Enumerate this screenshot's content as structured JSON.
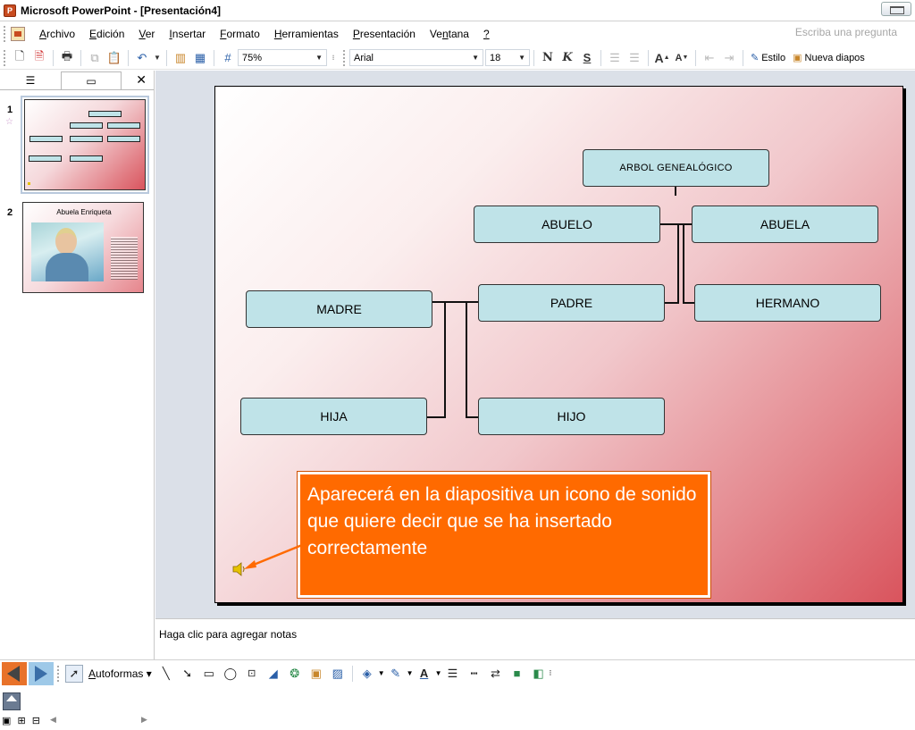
{
  "window": {
    "title": "Microsoft PowerPoint - [Presentación4]"
  },
  "menubar": {
    "items": [
      {
        "label": "Archivo",
        "key": "A",
        "rest": "rchivo"
      },
      {
        "label": "Edición",
        "key": "E",
        "rest": "dición"
      },
      {
        "label": "Ver",
        "key": "V",
        "rest": "er"
      },
      {
        "label": "Insertar",
        "key": "I",
        "rest": "nsertar"
      },
      {
        "label": "Formato",
        "key": "F",
        "rest": "ormato"
      },
      {
        "label": "Herramientas",
        "key": "H",
        "rest": "erramientas"
      },
      {
        "label": "Presentación",
        "key": "P",
        "rest": "resentación"
      },
      {
        "label": "Ventana",
        "pre": "Ve",
        "key": "n",
        "rest": "tana"
      },
      {
        "label": "?",
        "key": "?",
        "rest": ""
      }
    ],
    "ask_placeholder": "Escriba una pregunta"
  },
  "toolbar": {
    "zoom": "75%",
    "font": "Arial",
    "font_size": "18",
    "bold": "N",
    "italic": "K",
    "underline": "S",
    "grow_font": "A",
    "shrink_font": "A",
    "style_label": "Estilo",
    "new_slide_label": "Nueva diapos"
  },
  "left_pane": {
    "close": "✕",
    "slides": [
      {
        "number": "1"
      },
      {
        "number": "2",
        "title": "Abuela Enriqueta"
      }
    ]
  },
  "slide": {
    "boxes": {
      "title": "ARBOL GENEALÓGICO",
      "abuelo": "ABUELO",
      "abuela": "ABUELA",
      "madre": "MADRE",
      "padre": "PADRE",
      "hermano": "HERMANO",
      "hija": "HIJA",
      "hijo": "HIJO"
    },
    "callout": "Aparecerá en la diapositiva un icono de sonido que quiere decir que se ha insertado correctamente",
    "colors": {
      "box_fill": "#bfe3e8",
      "callout_fill": "#ff6a00",
      "arrow": "#ff6a00"
    }
  },
  "notes": {
    "placeholder": "Haga clic para agregar notas"
  },
  "drawbar": {
    "autoshapes": "Autoformas"
  }
}
